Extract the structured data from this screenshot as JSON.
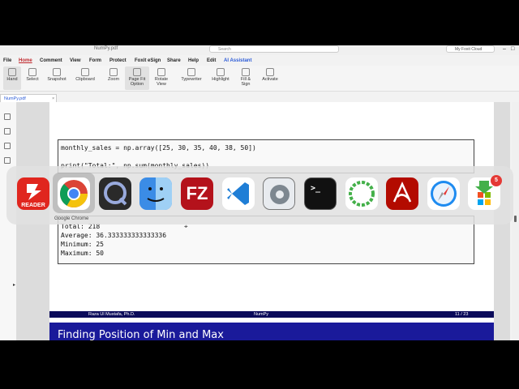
{
  "window": {
    "title": "NumPy.pdf",
    "search_placeholder": "Search",
    "user_label": "My Foxit Cloud"
  },
  "menu": [
    "File",
    "Home",
    "Comment",
    "View",
    "Form",
    "Protect",
    "Foxit eSign",
    "Share",
    "Help",
    "Edit",
    "AI Assistant"
  ],
  "ribbon": {
    "hand": "Hand",
    "select": "Select",
    "snapshot": "Snapshot",
    "clipboard": "Clipboard",
    "zoom": "Zoom",
    "page_fit": "Page Fit Option",
    "rotate": "Rotate View",
    "typewriter": "Typewriter",
    "highlight": "Highlight",
    "fill_sign": "Fill & Sign",
    "activate": "Activate"
  },
  "doc_tab": "NumPy.pdf",
  "code": {
    "line1": "monthly_sales = np.array([25, 30, 35, 40, 38, 50])",
    "line2": "print(\"Total:\", np.sum(monthly_sales))"
  },
  "output": {
    "line1": "Total: 218",
    "line2": "Average: 36.333333333333336",
    "line3": "Minimum: 25",
    "line4": "Maximum: 50"
  },
  "footer": {
    "author": "Raza Ul Mustafa, Ph.D.",
    "title": "NumPy",
    "page": "11 / 23"
  },
  "slide_title": "Finding Position of Min and Max",
  "dock": {
    "tooltip": "Google Chrome",
    "badge": "5",
    "apps": [
      {
        "name": "Foxit PDF Reader",
        "icon": "reader-icon",
        "label": "READER",
        "color": "#e0261e"
      },
      {
        "name": "Google Chrome",
        "icon": "chrome-icon",
        "color": "#ffffff"
      },
      {
        "name": "QuickTime Player",
        "icon": "quicktime-icon",
        "color": "#2a2a2a"
      },
      {
        "name": "Finder",
        "icon": "finder-icon",
        "color": "#3b8ce6"
      },
      {
        "name": "FileZilla",
        "icon": "filezilla-icon",
        "label": "FZ",
        "color": "#b4121b"
      },
      {
        "name": "Visual Studio Code",
        "icon": "vscode-icon",
        "color": "#ffffff"
      },
      {
        "name": "System Settings",
        "icon": "settings-icon",
        "color": "#9aa3ad"
      },
      {
        "name": "Terminal",
        "icon": "terminal-icon",
        "label": ">_",
        "color": "#111111"
      },
      {
        "name": "Anaconda",
        "icon": "anaconda-icon",
        "color": "#ffffff"
      },
      {
        "name": "Adobe Acrobat",
        "icon": "acrobat-icon",
        "color": "#b30b00"
      },
      {
        "name": "Safari",
        "icon": "safari-icon",
        "color": "#ffffff"
      },
      {
        "name": "Microsoft Office",
        "icon": "office-icon",
        "color": "#ffffff"
      }
    ]
  }
}
